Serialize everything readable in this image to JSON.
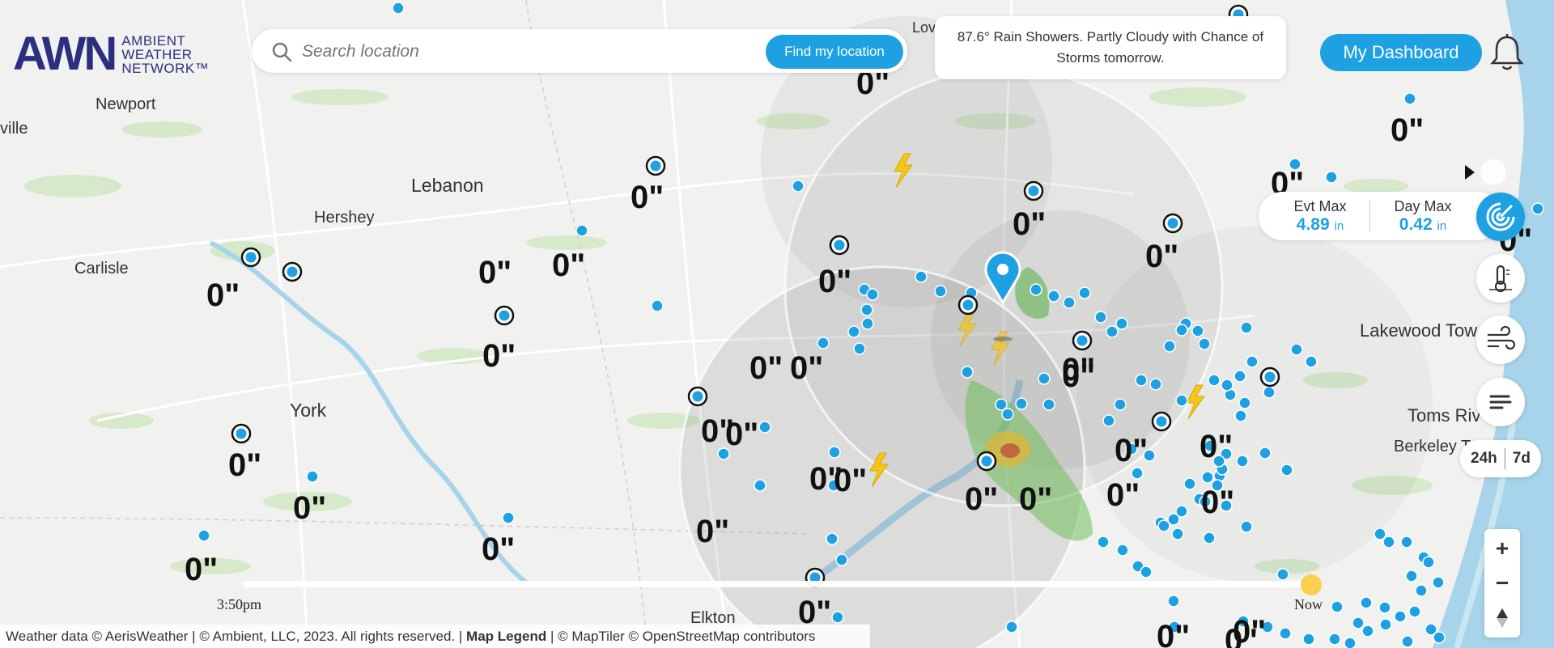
{
  "logo": {
    "mark": "AWN",
    "line1": "AMBIENT",
    "line2": "WEATHER",
    "line3": "NETWORK™"
  },
  "search": {
    "placeholder": "Search location",
    "find_label": "Find my location"
  },
  "forecast": {
    "text": "87.6° Rain Showers. Partly Cloudy with Chance of Storms tomorrow."
  },
  "dashboard_label": "My Dashboard",
  "max": {
    "evt_label": "Evt Max",
    "evt_value": "4.89",
    "day_label": "Day Max",
    "day_value": "0.42",
    "unit": "in"
  },
  "range": {
    "h": "24h",
    "d": "7d"
  },
  "timeline": {
    "start": "3:50pm",
    "end": "Now"
  },
  "attribution": {
    "part1": "Weather data © AerisWeather | © Ambient, LLC, 2023. All rights reserved. |",
    "legend": "Map Legend",
    "part2": "| © MapTiler © OpenStreetMap contributors"
  },
  "places": [
    "Newport",
    "ville",
    "Lebanon",
    "Hershey",
    "Carlisle",
    "York",
    "Elkton",
    "Lakewood Tow",
    "Toms Riv",
    "Berkeley T",
    "Lov"
  ],
  "rain_label": "0\"",
  "colors": {
    "accent": "#1da1e2",
    "brand": "#2b2f80",
    "lightning": "#f5c518",
    "now_dot": "#fccf4f"
  },
  "icons": [
    "search-icon",
    "bell-icon",
    "play-icon",
    "radar-icon",
    "thermometer-icon",
    "wind-icon",
    "menu-icon",
    "compass-icon"
  ]
}
